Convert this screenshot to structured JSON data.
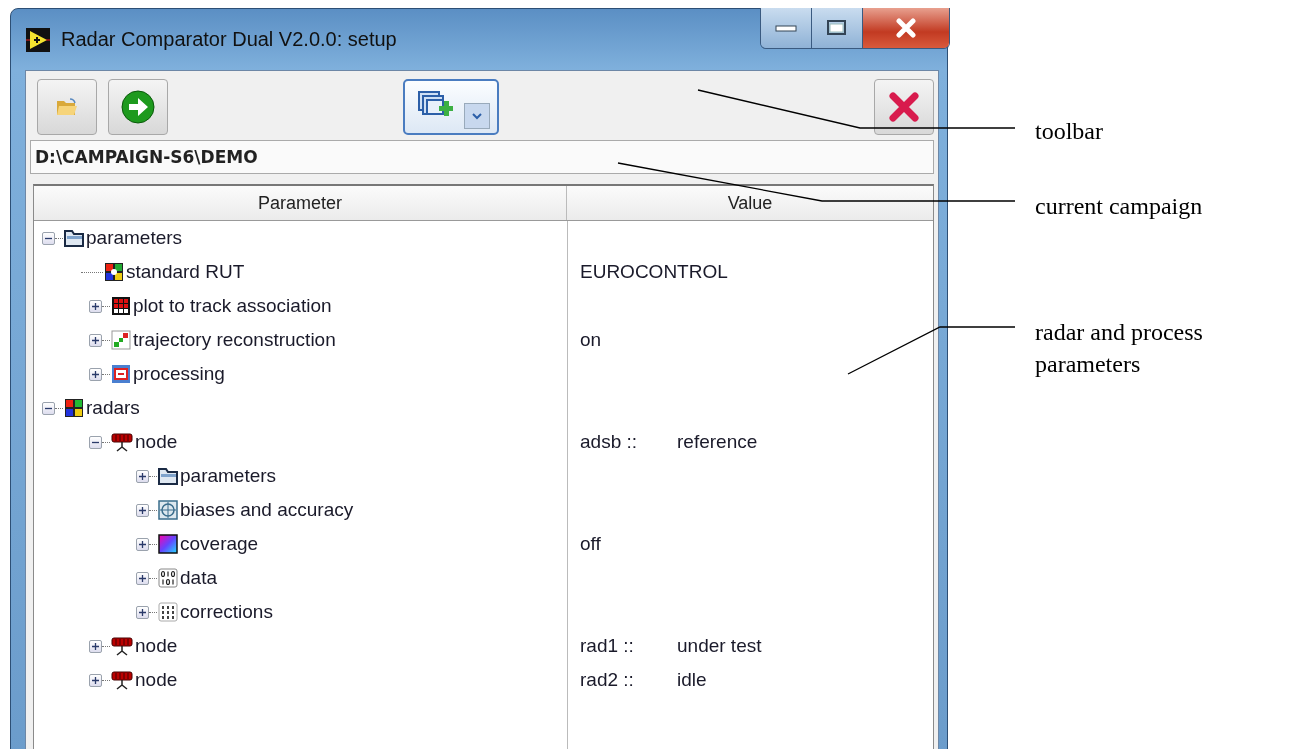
{
  "window": {
    "title": "Radar Comparator Dual V2.0.0: setup"
  },
  "toolbar": {
    "buttons": [
      {
        "kind": "open"
      },
      {
        "kind": "go"
      },
      {
        "kind": "add-window"
      },
      {
        "kind": "cancel"
      }
    ]
  },
  "campaign_path": "D:\\CAMPAIGN-S6\\DEMO",
  "table": {
    "columns": [
      "Parameter",
      "Value"
    ],
    "tree": [
      {
        "label": "parameters",
        "kind": "folder",
        "expanded": true,
        "children": [
          {
            "label": "standard RUT",
            "kind": "standard",
            "value": "EUROCONTROL"
          },
          {
            "label": "plot to track association",
            "kind": "association",
            "expanded": false
          },
          {
            "label": "trajectory reconstruction",
            "kind": "trajectory",
            "expanded": false,
            "value": "on"
          },
          {
            "label": "processing",
            "kind": "processing",
            "expanded": false
          }
        ]
      },
      {
        "label": "radars",
        "kind": "radar-group",
        "expanded": true,
        "children": [
          {
            "label": "node",
            "kind": "node",
            "expanded": true,
            "value": "adsb ::",
            "status": "reference",
            "children": [
              {
                "label": "parameters",
                "kind": "folder",
                "expanded": false
              },
              {
                "label": "biases and accuracy",
                "kind": "biases",
                "expanded": false
              },
              {
                "label": "coverage",
                "kind": "coverage",
                "expanded": false,
                "value": "off"
              },
              {
                "label": "data",
                "kind": "data",
                "expanded": false
              },
              {
                "label": "corrections",
                "kind": "corrections",
                "expanded": false
              }
            ]
          },
          {
            "label": "node",
            "kind": "node",
            "expanded": false,
            "value": "rad1 ::",
            "status": "under test"
          },
          {
            "label": "node",
            "kind": "node",
            "expanded": false,
            "value": "rad2 ::",
            "status": "idle"
          }
        ]
      }
    ]
  },
  "annotations": [
    {
      "text": "toolbar"
    },
    {
      "text": "current campaign"
    },
    {
      "text": "radar and process parameters"
    }
  ]
}
